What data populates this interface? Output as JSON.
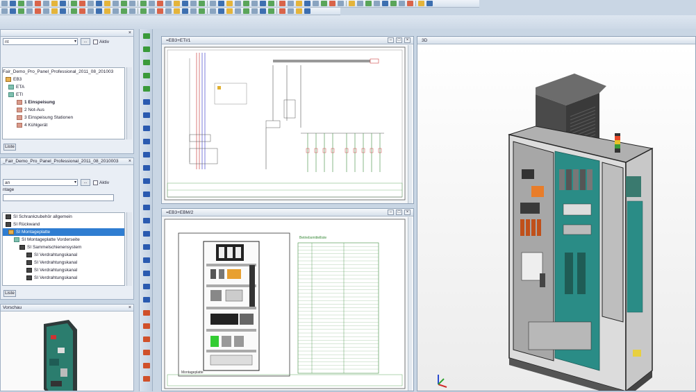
{
  "left_panel_1": {
    "close": "×",
    "select_value": "nt",
    "checkbox_label": "Aktiv",
    "tree": [
      {
        "label": "Fair_Demo_Pro_Panel_Professional_2011_08_201003",
        "kind": "none"
      },
      {
        "label": "EB3",
        "kind": "f"
      },
      {
        "label": "ETA",
        "kind": "t"
      },
      {
        "label": "ETI",
        "kind": "t"
      },
      {
        "label": "1 Einspeisung",
        "kind": "p"
      },
      {
        "label": "2 Not-Aus",
        "kind": "p"
      },
      {
        "label": "3 Einspeisung Stationen",
        "kind": "p"
      },
      {
        "label": "4 Kühlgerät",
        "kind": "p"
      }
    ],
    "list_button": "Liste"
  },
  "left_panel_2": {
    "title": "_Fair_Demo_Pro_Panel_Professional_2011_08_2010003",
    "close": "×",
    "select_value": "an",
    "checkbox_label": "Aktiv",
    "section_label": "ntage",
    "tree": [
      {
        "label": "SI Schrankzubehör allgemein",
        "kind": "d"
      },
      {
        "label": "SI Rückwand",
        "kind": "d"
      },
      {
        "label": "SI Montageplatte",
        "kind": "f"
      },
      {
        "label": "SI Montageplatte Vorderseite",
        "kind": "t"
      },
      {
        "label": "SI Sammelschienensystem",
        "kind": "d"
      },
      {
        "label": "SI Verdrahtungskanal",
        "kind": "d"
      },
      {
        "label": "SI Verdrahtungskanal",
        "kind": "d"
      },
      {
        "label": "SI Verdrahtungskanal",
        "kind": "d"
      },
      {
        "label": "SI Verdrahtungskanal",
        "kind": "d"
      }
    ],
    "list_button": "Liste"
  },
  "left_panel_3": {
    "title": "Vorschau",
    "close": "×"
  },
  "docs": {
    "schematic": {
      "title": "=EB3+ETI/1"
    },
    "layout": {
      "title": "=EB3+EBM/2",
      "legend_title": "Betriebsmittelliste",
      "plate_label": "Montageplatte"
    },
    "view3d": {
      "title": "3D"
    }
  },
  "window_controls": {
    "minimize": "–",
    "maximize": "□",
    "close": "×"
  },
  "colors": {
    "accent": "#2f7dd1",
    "cabinet_teal": "#2a8c86",
    "orange": "#e87d2a"
  }
}
